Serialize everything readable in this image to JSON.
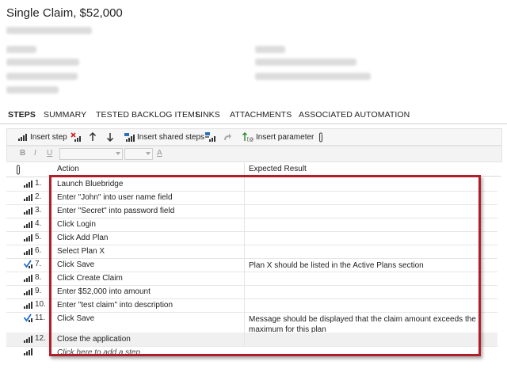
{
  "header": {
    "title": "Single Claim, $52,000"
  },
  "tabs": [
    {
      "label": "STEPS",
      "active": true
    },
    {
      "label": "SUMMARY"
    },
    {
      "label": "TESTED BACKLOG ITEMS"
    },
    {
      "label": "LINKS"
    },
    {
      "label": "ATTACHMENTS"
    },
    {
      "label": "ASSOCIATED AUTOMATION"
    }
  ],
  "toolbar": {
    "insert_step": "Insert step",
    "insert_shared_steps": "Insert shared steps",
    "insert_parameter": "Insert parameter"
  },
  "format": {
    "bold": "B",
    "italic": "I",
    "underline": "U",
    "font_color": "A"
  },
  "columns": {
    "action": "Action",
    "expected": "Expected Result"
  },
  "steps": [
    {
      "num": "1.",
      "action": "Launch Bluebridge",
      "expected": "",
      "validate": false
    },
    {
      "num": "2.",
      "action": "Enter \"John\" into user name field",
      "expected": "",
      "validate": false
    },
    {
      "num": "3.",
      "action": "Enter \"Secret\" into password field",
      "expected": "",
      "validate": false
    },
    {
      "num": "4.",
      "action": "Click Login",
      "expected": "",
      "validate": false
    },
    {
      "num": "5.",
      "action": "Click Add Plan",
      "expected": "",
      "validate": false
    },
    {
      "num": "6.",
      "action": "Select Plan X",
      "expected": "",
      "validate": false
    },
    {
      "num": "7.",
      "action": "Click Save",
      "expected": "Plan X should be listed in the Active Plans section",
      "validate": true
    },
    {
      "num": "8.",
      "action": "Click Create Claim",
      "expected": "",
      "validate": false
    },
    {
      "num": "9.",
      "action": "Enter $52,000 into amount",
      "expected": "",
      "validate": false
    },
    {
      "num": "10.",
      "action": "Enter \"test claim\" into description",
      "expected": "",
      "validate": false
    },
    {
      "num": "11.",
      "action": "Click Save",
      "expected": "Message should be displayed that the claim amount exceeds the maximum for this plan",
      "validate": true
    },
    {
      "num": "12.",
      "action": "Close the application",
      "expected": "",
      "validate": false
    }
  ],
  "add_step": "Click here to add a step",
  "colors": {
    "highlight": "#b01e2a",
    "check": "#1e6fd0",
    "delete": "#d42020"
  },
  "icons": {
    "step": "step-bars-icon",
    "validate": "validate-check-icon",
    "attachment": "paperclip-icon"
  }
}
